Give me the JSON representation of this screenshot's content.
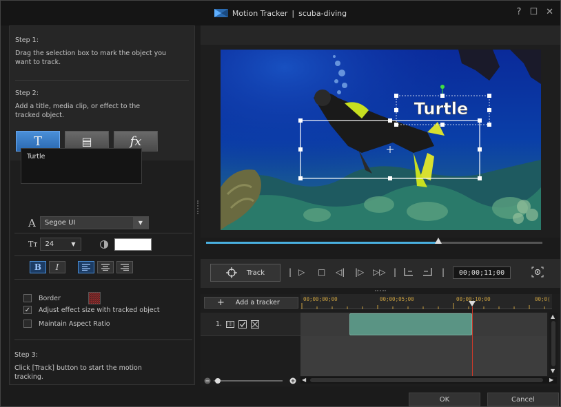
{
  "window": {
    "title": "Motion Tracker",
    "separator": "|",
    "project": "scuba-diving",
    "help_label": "?",
    "maximize_label": "☐",
    "close_label": "✕"
  },
  "left": {
    "step1_title": "Step 1:",
    "step1_text": "Drag the selection box to mark the object you want to track.",
    "step2_title": "Step 2:",
    "step2_text": "Add a title, media clip, or effect to the tracked object.",
    "object_buttons": {
      "title": "T",
      "media": "▤",
      "effect": "fx"
    },
    "title_text": "Turtle",
    "font_label": "A",
    "font_name": "Segoe UI",
    "size_icon": "Tт",
    "font_size": "24",
    "text_color": "#ffffff",
    "bold": "B",
    "italic": "I",
    "border_label": "Border",
    "adjust_label": "Adjust effect size with tracked object",
    "adjust_checked": true,
    "aspect_label": "Maintain Aspect Ratio",
    "step3_title": "Step 3:",
    "step3_text": "Click [Track] button to start the motion tracking."
  },
  "preview": {
    "overlay_text": "Turtle",
    "scrub_progress": 0.69
  },
  "controls": {
    "track_label": "Track",
    "sep": "|",
    "play": "▷",
    "stop": "□",
    "prev_frame": "◁|",
    "next_frame": "|▷",
    "fast_forward": "▷▷",
    "mark_in": "[",
    "mark_out": "]",
    "timecode": "00;00;11;00"
  },
  "timeline": {
    "add_tracker_label": "Add a tracker",
    "ruler": [
      "00;00;00;00",
      "00;00;05;00",
      "00;00;10;00",
      "00;0("
    ],
    "track_number": "1.",
    "scroll_up": "▲",
    "scroll_down": "▼",
    "scroll_left": "◀",
    "scroll_right": "▶"
  },
  "footer": {
    "ok_label": "OK",
    "cancel_label": "Cancel"
  },
  "colors": {
    "accent": "#4a8fd8",
    "clip": "#5a9484",
    "playhead": "#c83a2a",
    "scrub": "#4ab0e0"
  }
}
